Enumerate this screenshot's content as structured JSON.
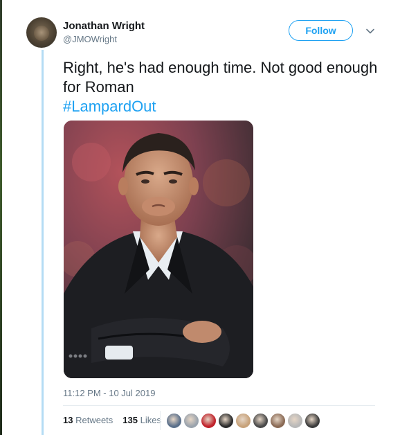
{
  "author": {
    "name": "Jonathan Wright",
    "handle": "@JMOWright"
  },
  "follow_label": "Follow",
  "tweet": {
    "text": "Right, he's had enough time. Not good enough for Roman",
    "hashtag": "#LampardOut"
  },
  "timestamp": "11:12 PM - 10 Jul 2019",
  "stats": {
    "retweets_count": "13",
    "retweets_label": "Retweets",
    "likes_count": "135",
    "likes_label": "Likes"
  },
  "likers": [
    {
      "icon": "liker-avatar",
      "color": "#5a6f8a"
    },
    {
      "icon": "liker-avatar",
      "color": "#9aa3ad"
    },
    {
      "icon": "liker-avatar",
      "color": "#c0222b"
    },
    {
      "icon": "liker-avatar",
      "color": "#2b2b2b"
    },
    {
      "icon": "liker-avatar",
      "color": "#c7a27a"
    },
    {
      "icon": "liker-avatar",
      "color": "#4a4a4a"
    },
    {
      "icon": "liker-avatar",
      "color": "#8a6a55"
    },
    {
      "icon": "liker-avatar",
      "color": "#b8b8b8"
    },
    {
      "icon": "liker-avatar",
      "color": "#3c3c3c"
    }
  ],
  "colors": {
    "accent": "#1da1f2",
    "thread_line": "#b4dcf4",
    "text": "#14171a",
    "muted": "#657786"
  }
}
